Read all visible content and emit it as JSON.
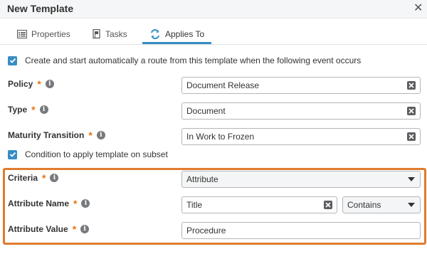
{
  "dialog": {
    "title": "New Template"
  },
  "tabs": [
    {
      "label": "Properties",
      "icon": "list-icon"
    },
    {
      "label": "Tasks",
      "icon": "flag-icon"
    },
    {
      "label": "Applies To",
      "icon": "sync-icon"
    }
  ],
  "active_tab": "Applies To",
  "options": {
    "auto_route": {
      "checked": true,
      "label": "Create and start automatically a route from this template when the following event occurs"
    },
    "subset": {
      "checked": true,
      "label": "Condition to apply template on subset"
    }
  },
  "fields": {
    "policy": {
      "label": "Policy",
      "value": "Document Release"
    },
    "type": {
      "label": "Type",
      "value": "Document"
    },
    "maturity": {
      "label": "Maturity Transition",
      "value": "In Work to Frozen"
    },
    "criteria": {
      "label": "Criteria",
      "value": "Attribute"
    },
    "attribute_name": {
      "label": "Attribute Name",
      "value": "Title",
      "operator": "Contains"
    },
    "attribute_value": {
      "label": "Attribute Value",
      "value": "Procedure"
    }
  },
  "colors": {
    "accent": "#368ec4",
    "required_star": "#e87511",
    "highlight": "#e07b2e"
  }
}
